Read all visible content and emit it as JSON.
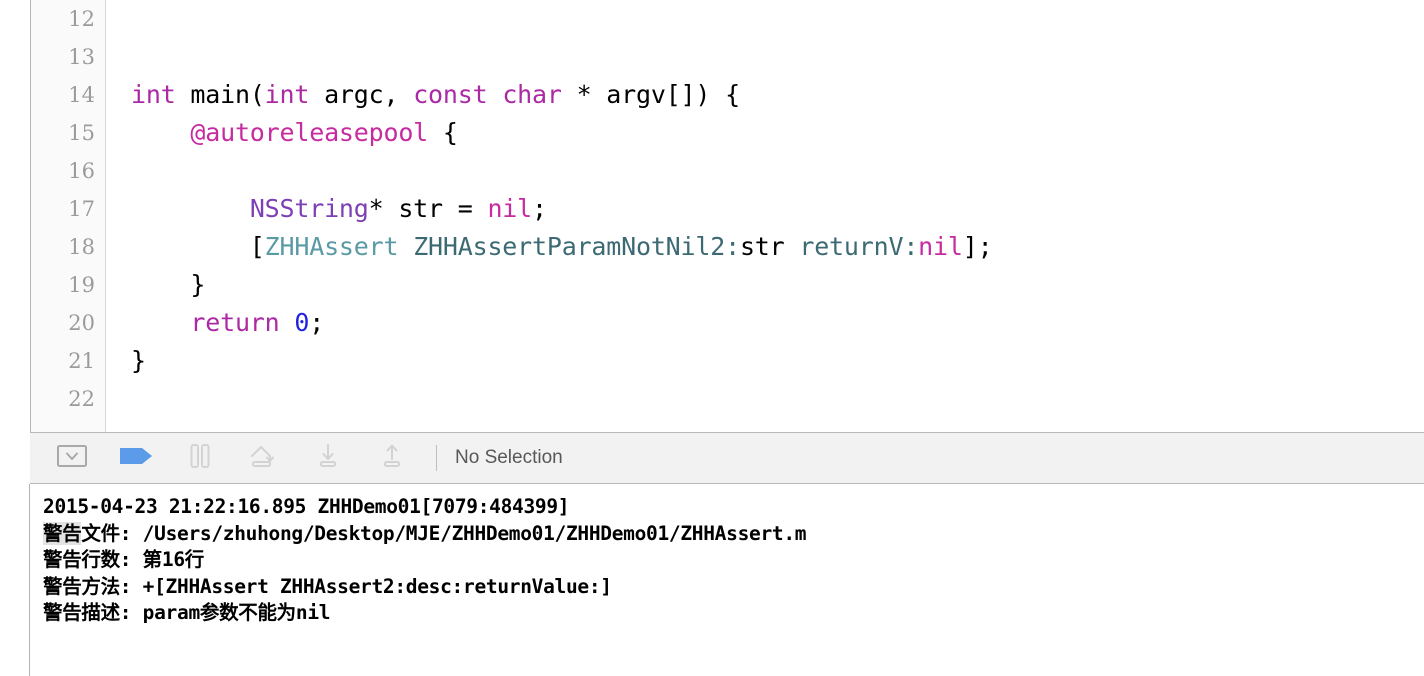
{
  "app": "xcode-debug-view",
  "editor": {
    "gutter_lines": [
      "12",
      "13",
      "14",
      "15",
      "16",
      "17",
      "18",
      "19",
      "20",
      "21",
      "22"
    ],
    "code_lines": [
      {
        "n": "12",
        "tokens": []
      },
      {
        "n": "13",
        "tokens": []
      },
      {
        "n": "14",
        "tokens": [
          {
            "t": "int",
            "c": "kw"
          },
          {
            "t": " main(",
            "c": "plain"
          },
          {
            "t": "int",
            "c": "kw"
          },
          {
            "t": " argc, ",
            "c": "plain"
          },
          {
            "t": "const",
            "c": "kw"
          },
          {
            "t": " ",
            "c": "plain"
          },
          {
            "t": "char",
            "c": "kw"
          },
          {
            "t": " * argv[]) {",
            "c": "plain"
          }
        ]
      },
      {
        "n": "15",
        "tokens": [
          {
            "t": "    ",
            "c": "plain"
          },
          {
            "t": "@autoreleasepool",
            "c": "kwpink"
          },
          {
            "t": " {",
            "c": "plain"
          }
        ]
      },
      {
        "n": "16",
        "tokens": []
      },
      {
        "n": "17",
        "tokens": [
          {
            "t": "        ",
            "c": "plain"
          },
          {
            "t": "NSString",
            "c": "type"
          },
          {
            "t": "* str = ",
            "c": "plain"
          },
          {
            "t": "nil",
            "c": "nil"
          },
          {
            "t": ";",
            "c": "plain"
          }
        ]
      },
      {
        "n": "18",
        "tokens": [
          {
            "t": "        [",
            "c": "plain"
          },
          {
            "t": "ZHHAssert",
            "c": "cls"
          },
          {
            "t": " ",
            "c": "plain"
          },
          {
            "t": "ZHHAssertParamNotNil2:",
            "c": "sel"
          },
          {
            "t": "str",
            "c": "plain"
          },
          {
            "t": " ",
            "c": "plain"
          },
          {
            "t": "returnV:",
            "c": "sel"
          },
          {
            "t": "nil",
            "c": "nil"
          },
          {
            "t": "];",
            "c": "plain"
          }
        ]
      },
      {
        "n": "19",
        "tokens": [
          {
            "t": "    }",
            "c": "plain"
          }
        ]
      },
      {
        "n": "20",
        "tokens": [
          {
            "t": "    ",
            "c": "plain"
          },
          {
            "t": "return",
            "c": "kw"
          },
          {
            "t": " ",
            "c": "plain"
          },
          {
            "t": "0",
            "c": "num"
          },
          {
            "t": ";",
            "c": "plain"
          }
        ]
      },
      {
        "n": "21",
        "tokens": [
          {
            "t": "}",
            "c": "plain"
          }
        ]
      },
      {
        "n": "22",
        "tokens": []
      }
    ],
    "colors": {
      "keyword": "#ac29a4",
      "directive": "#c62ba0",
      "type": "#7d3fb5",
      "nil_literal": "#c62ba0",
      "number": "#2323dd",
      "class_name": "#5a9aa5",
      "selector": "#3c6a73",
      "gutter_text": "#9b9b9b"
    }
  },
  "debug_bar": {
    "buttons": [
      {
        "name": "hide-debug-area-button",
        "icon": "panel-collapse-icon",
        "label": "Hide Debug Area"
      },
      {
        "name": "deactivate-breakpoints-button",
        "icon": "breakpoint-flag-icon",
        "label": "Deactivate Breakpoints"
      },
      {
        "name": "pause-button",
        "icon": "pause-icon",
        "label": "Pause program execution"
      },
      {
        "name": "step-over-button",
        "icon": "step-over-icon",
        "label": "Step over"
      },
      {
        "name": "step-into-button",
        "icon": "step-into-icon",
        "label": "Step into"
      },
      {
        "name": "step-out-button",
        "icon": "step-out-icon",
        "label": "Step out"
      }
    ],
    "selection_label": "No Selection",
    "accent_color": "#5b9bea"
  },
  "console": {
    "lines": [
      {
        "id": "timestamp-line",
        "segments": [
          {
            "t": "2015-04-23 21:22:16.895 ZHHDemo01[7079:484399]",
            "hl": false
          }
        ]
      },
      {
        "id": "warning-file-line",
        "segments": [
          {
            "t": "警告",
            "hl": true
          },
          {
            "t": "文件: /Users/zhuhong/Desktop/MJE/ZHHDemo01/ZHHDemo01/ZHHAssert.m",
            "hl": false
          }
        ]
      },
      {
        "id": "warning-line-number-line",
        "segments": [
          {
            "t": "警告行数: 第16行",
            "hl": false
          }
        ]
      },
      {
        "id": "warning-method-line",
        "segments": [
          {
            "t": "警告方法: +[ZHHAssert ZHHAssert2:desc:returnValue:]",
            "hl": false
          }
        ]
      },
      {
        "id": "warning-description-line",
        "segments": [
          {
            "t": "警告描述: param参数不能为nil",
            "hl": false
          }
        ]
      }
    ]
  }
}
